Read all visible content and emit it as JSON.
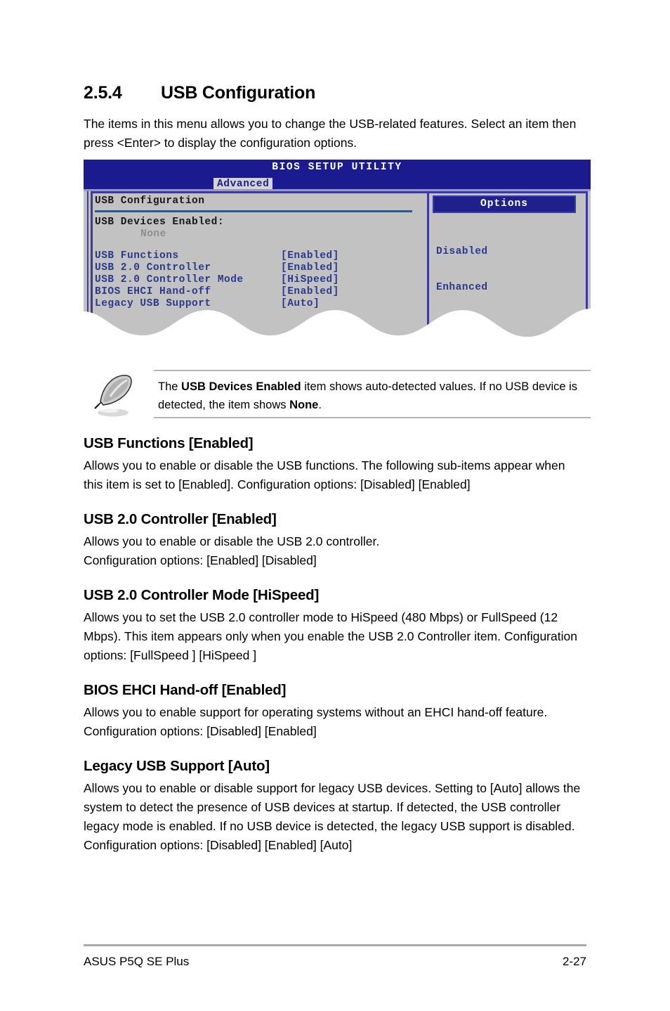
{
  "section": {
    "number": "2.5.4",
    "title": "USB Configuration",
    "intro": "The items in this menu allows you to change the USB-related features. Select an item then press <Enter> to display the configuration options."
  },
  "bios": {
    "title": "BIOS SETUP UTILITY",
    "tab": "Advanced",
    "left_panel": {
      "heading": "USB Configuration",
      "devices_label": "USB Devices Enabled:",
      "devices_value": "None",
      "items": [
        {
          "name": "USB Functions",
          "value": "[Enabled]"
        },
        {
          "name": "USB 2.0 Controller",
          "value": "[Enabled]"
        },
        {
          "name": "USB 2.0 Controller Mode",
          "value": "[HiSpeed]"
        },
        {
          "name": "BIOS EHCI Hand-off",
          "value": "[Enabled]"
        },
        {
          "name": "Legacy USB Support",
          "value": "[Auto]"
        }
      ]
    },
    "right_panel": {
      "heading": "Options",
      "options": [
        "Disabled",
        "Enhanced"
      ]
    },
    "colors": {
      "titlebar": "#1b1b8f",
      "panel_bg": "#c2c2c2",
      "frame": "#3b3b9e",
      "item_text": "#2b3a8c",
      "rule": "#1a5eab",
      "dim_text": "#8e8e8e"
    }
  },
  "note": {
    "icon": "quill-pen-icon",
    "text_part1": "The ",
    "bold1": "USB Devices Enabled",
    "text_part2": " item shows auto-detected values. If no USB device is detected, the item shows ",
    "bold2": "None",
    "text_part3": "."
  },
  "subsections": [
    {
      "heading": "USB Functions [Enabled]",
      "body": "Allows you to enable or disable the USB functions. The following sub-items appear when this item is set to [Enabled]. Configuration options: [Disabled] [Enabled]"
    },
    {
      "heading": "USB 2.0 Controller [Enabled]",
      "body": "Allows you to enable or disable the USB 2.0 controller.\nConfiguration options: [Enabled] [Disabled]"
    },
    {
      "heading": "USB 2.0 Controller Mode [HiSpeed]",
      "body": "Allows you to set the USB 2.0 controller mode to HiSpeed (480 Mbps) or FullSpeed (12 Mbps). This item appears only when you enable the USB 2.0 Controller item. Configuration options: [FullSpeed ] [HiSpeed ]"
    },
    {
      "heading": "BIOS EHCI Hand-off [Enabled]",
      "body": "Allows you to enable support for operating systems without an EHCI hand-off feature. Configuration options: [Disabled] [Enabled]"
    },
    {
      "heading": "Legacy USB Support [Auto]",
      "body": "Allows you to enable or disable support for legacy USB devices. Setting to [Auto] allows the system to detect the presence of USB devices at startup. If detected, the USB controller legacy mode is enabled. If no USB device is detected, the legacy USB support is disabled. Configuration options: [Disabled] [Enabled] [Auto]"
    }
  ],
  "footer": {
    "left": "ASUS P5Q SE Plus",
    "page": "2-27"
  }
}
